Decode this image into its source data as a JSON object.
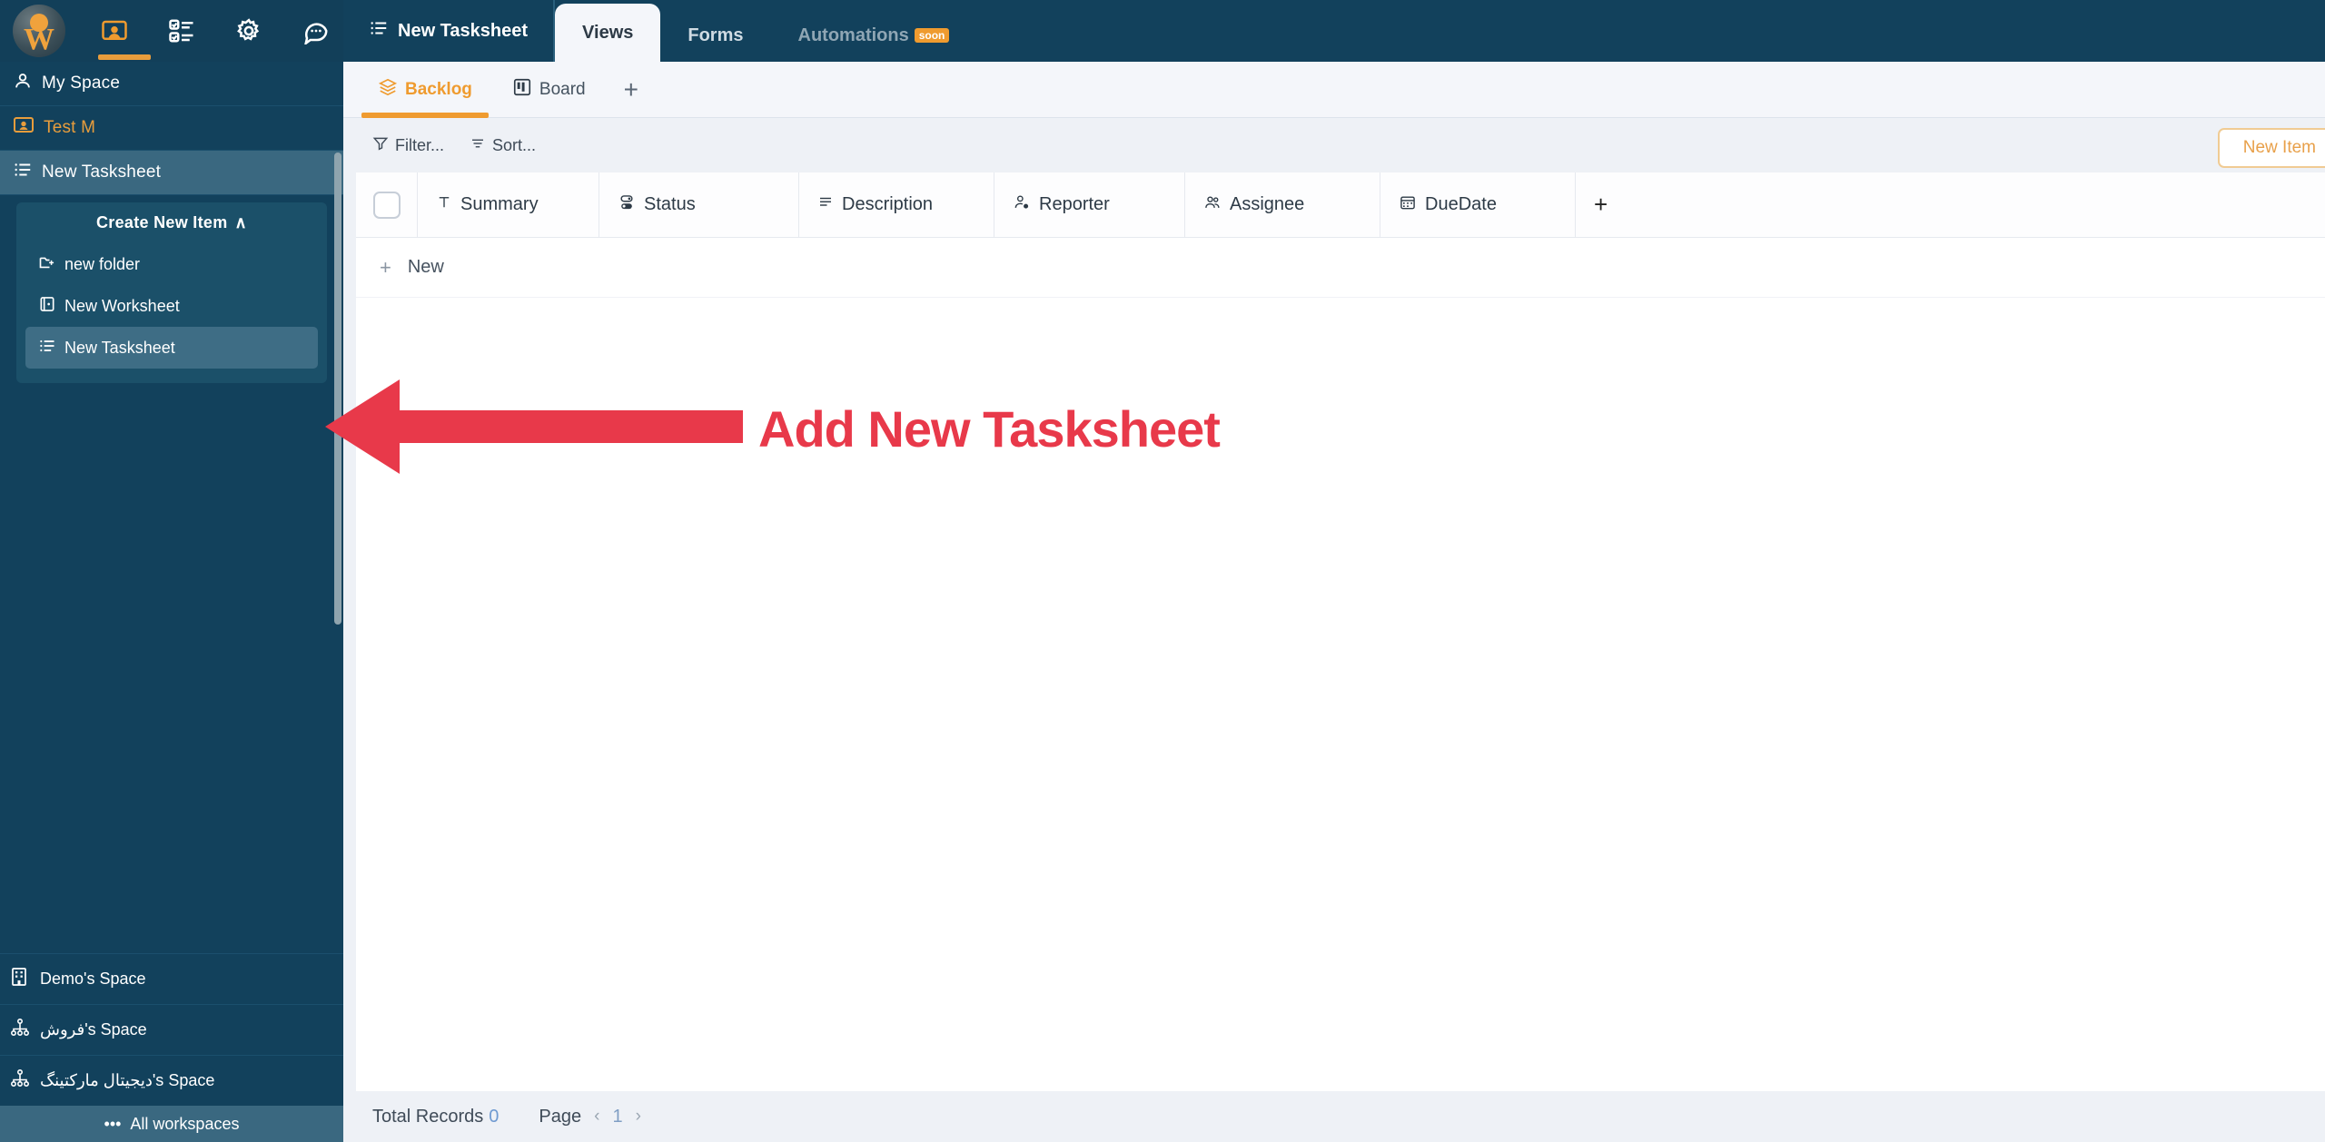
{
  "sidebar": {
    "icons": [
      {
        "name": "avatar",
        "label": "User avatar"
      },
      {
        "name": "workspace-icon",
        "label": "Workspace"
      },
      {
        "name": "tasks-icon",
        "label": "Tasks"
      },
      {
        "name": "gear-icon",
        "label": "Settings"
      },
      {
        "name": "chat-icon",
        "label": "Chat"
      }
    ],
    "rows": [
      {
        "label": "My Space",
        "icon": "person-icon"
      },
      {
        "label": "Test M",
        "icon": "workspace-icon"
      },
      {
        "label": "New Tasksheet",
        "icon": "tasksheet-icon"
      }
    ],
    "create_panel": {
      "title": "Create New Item",
      "chevron": "∧",
      "items": [
        {
          "label": "new folder",
          "icon": "new-folder-icon"
        },
        {
          "label": "New Worksheet",
          "icon": "new-worksheet-icon"
        },
        {
          "label": "New Tasksheet",
          "icon": "new-tasksheet-icon"
        }
      ]
    },
    "workspaces": [
      {
        "label": "Demo's Space",
        "icon": "building-icon"
      },
      {
        "label": "فروش's Space",
        "icon": "org-icon"
      },
      {
        "label": "دیجیتال مارکتینگ's Space",
        "icon": "org-icon"
      }
    ],
    "all_workspaces": "All workspaces",
    "all_workspaces_dots": "•••"
  },
  "topbar": {
    "sheet_name": "New Tasksheet",
    "tabs": [
      {
        "label": "Views",
        "active": true,
        "badge": ""
      },
      {
        "label": "Forms",
        "active": false,
        "badge": ""
      },
      {
        "label": "Automations",
        "active": false,
        "badge": "soon"
      }
    ]
  },
  "viewbar": {
    "views": [
      {
        "label": "Backlog",
        "icon": "layers-icon",
        "active": true
      },
      {
        "label": "Board",
        "icon": "board-icon",
        "active": false
      }
    ],
    "add_view": "+"
  },
  "toolbar": {
    "filter_label": "Filter...",
    "sort_label": "Sort...",
    "new_item_label": "New Item"
  },
  "table": {
    "columns": [
      {
        "label": "Summary",
        "icon": "text-icon"
      },
      {
        "label": "Status",
        "icon": "status-icon"
      },
      {
        "label": "Description",
        "icon": "description-icon"
      },
      {
        "label": "Reporter",
        "icon": "reporter-icon"
      },
      {
        "label": "Assignee",
        "icon": "assignee-icon"
      },
      {
        "label": "DueDate",
        "icon": "calendar-icon"
      }
    ],
    "add_column": "+",
    "new_row_label": "New",
    "new_row_plus": "+"
  },
  "footer": {
    "total_records_label": "Total Records",
    "total_records_value": "0",
    "page_label": "Page",
    "prev": "‹",
    "page_number": "1",
    "next": "›"
  },
  "annotation": {
    "text": "Add New Tasksheet",
    "color": "#e8394a"
  },
  "colors": {
    "sidebar_bg": "#12415c",
    "accent": "#ef9b2f",
    "selected": "#3a6880",
    "annotation_red": "#e8394a",
    "panel_bg": "#1b5069"
  }
}
